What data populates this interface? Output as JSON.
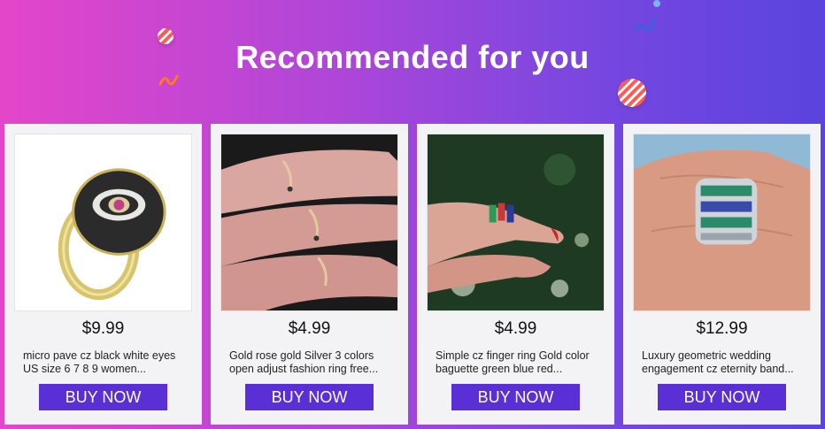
{
  "banner": {
    "title": "Recommended for you"
  },
  "colors": {
    "gradient_start": "#e446c9",
    "gradient_end": "#5a43de",
    "button": "#5b2fd6",
    "card": "#f3f3f5"
  },
  "products": [
    {
      "price": "$9.99",
      "title": "micro pave cz black white eyes US size 6 7 8 9 women...",
      "button": "BUY NOW",
      "image": "gold-evil-eye-signet-ring"
    },
    {
      "price": "$4.99",
      "title": "Gold rose gold Silver 3 colors open adjust fashion ring free...",
      "button": "BUY NOW",
      "image": "snake-open-rings-on-hand"
    },
    {
      "price": "$4.99",
      "title": "Simple cz finger ring Gold color baguette green blue red...",
      "button": "BUY NOW",
      "image": "baguette-stone-ring-on-finger"
    },
    {
      "price": "$12.99",
      "title": "Luxury geometric wedding engagement cz eternity band...",
      "button": "BUY NOW",
      "image": "wide-eternity-band-on-hand"
    }
  ]
}
